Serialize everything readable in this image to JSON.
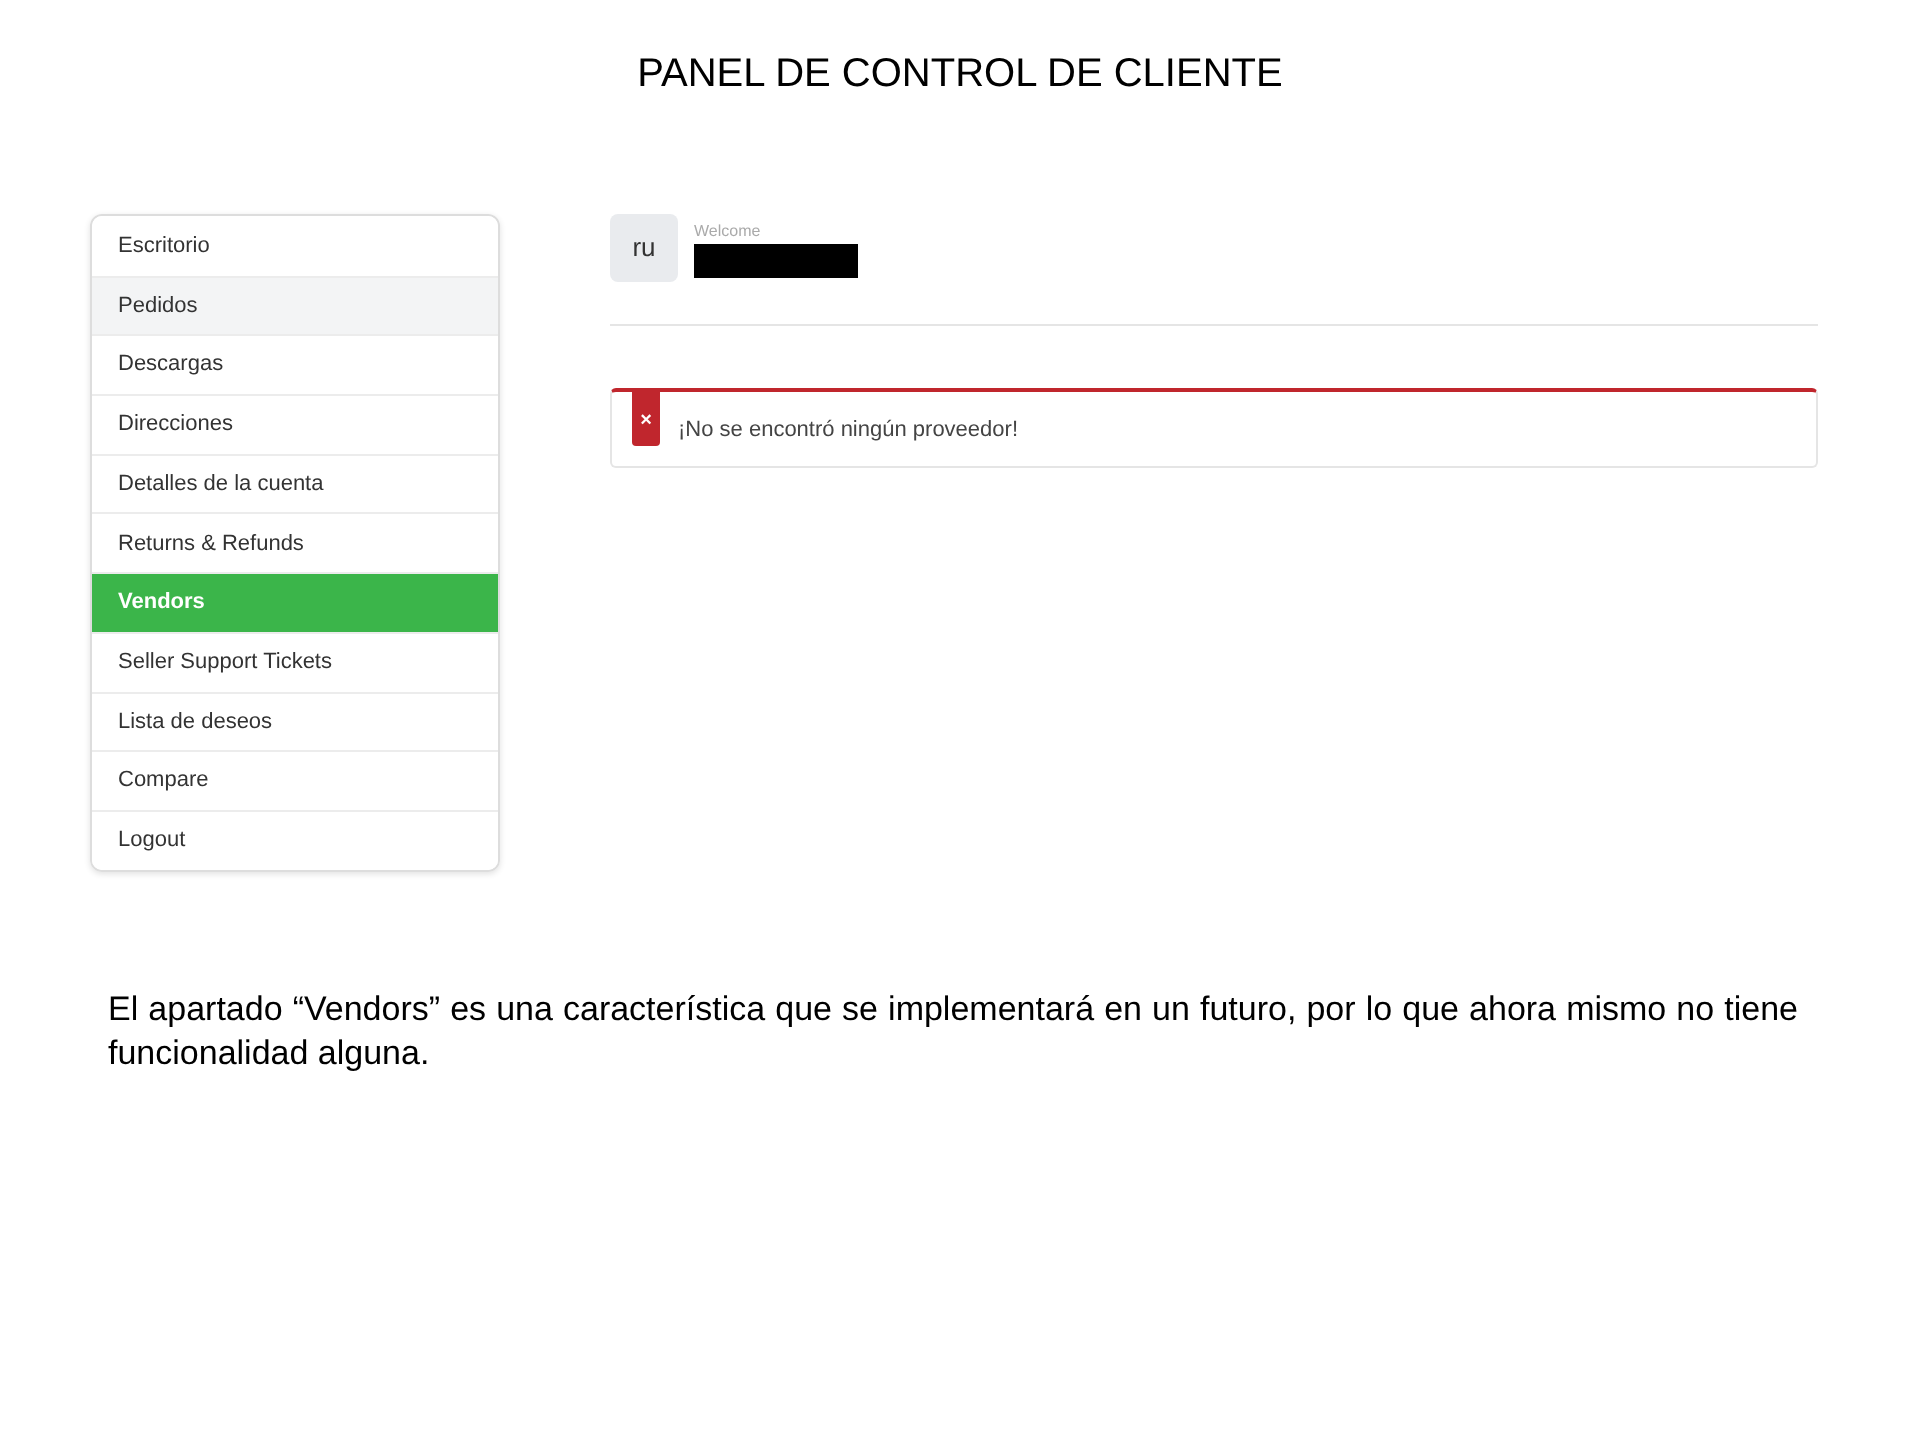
{
  "title": "PANEL DE CONTROL DE CLIENTE",
  "sidebar": {
    "items": [
      {
        "label": "Escritorio",
        "selected": false,
        "hovered": false
      },
      {
        "label": "Pedidos",
        "selected": false,
        "hovered": true
      },
      {
        "label": "Descargas",
        "selected": false,
        "hovered": false
      },
      {
        "label": "Direcciones",
        "selected": false,
        "hovered": false
      },
      {
        "label": "Detalles de la cuenta",
        "selected": false,
        "hovered": false
      },
      {
        "label": "Returns & Refunds",
        "selected": false,
        "hovered": false
      },
      {
        "label": "Vendors",
        "selected": true,
        "hovered": false
      },
      {
        "label": "Seller Support Tickets",
        "selected": false,
        "hovered": false
      },
      {
        "label": "Lista de deseos",
        "selected": false,
        "hovered": false
      },
      {
        "label": "Compare",
        "selected": false,
        "hovered": false
      },
      {
        "label": "Logout",
        "selected": false,
        "hovered": false
      }
    ]
  },
  "user": {
    "avatar": "ru",
    "greeting": "Welcome",
    "name_redacted": true
  },
  "alert": {
    "icon": "×",
    "message": "¡No se encontró ningún proveedor!"
  },
  "caption": "El apartado “Vendors” es una característica que se implementará en un futuro, por lo que ahora mismo no tiene funcionalidad alguna."
}
